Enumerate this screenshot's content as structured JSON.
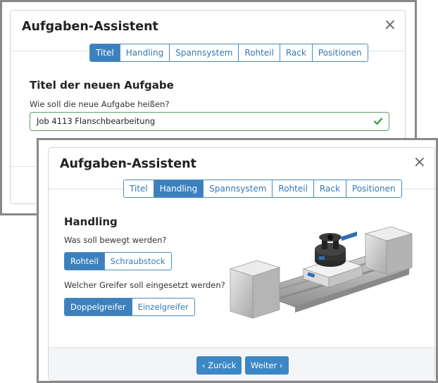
{
  "back_dialog": {
    "title": "Aufgaben-Assistent",
    "close_glyph": "×",
    "tabs": [
      "Titel",
      "Handling",
      "Spannsystem",
      "Rohteil",
      "Rack",
      "Positionen"
    ],
    "active_tab": "Titel",
    "section_title": "Titel der neuen Aufgabe",
    "question": "Wie soll die neue Aufgabe heißen?",
    "input_value": "Job 4113 Flanschbearbeitung",
    "input_valid": true
  },
  "front_dialog": {
    "title": "Aufgaben-Assistent",
    "close_glyph": "×",
    "tabs": [
      "Titel",
      "Handling",
      "Spannsystem",
      "Rohteil",
      "Rack",
      "Positionen"
    ],
    "active_tab": "Handling",
    "section_title": "Handling",
    "question_move": "Was soll bewegt werden?",
    "move_options": [
      "Rohteil",
      "Schraubstock"
    ],
    "move_selected": "Rohteil",
    "question_gripper": "Welcher Greifer soll eingesetzt werden?",
    "gripper_options": [
      "Doppelgreifer",
      "Einzelgreifer"
    ],
    "gripper_selected": "Doppelgreifer",
    "back_button": "‹ Zurück",
    "next_button": "Weiter ›",
    "image": "gripper-machine-illustration"
  },
  "colors": {
    "accent": "#3c81be",
    "valid": "#2e9a45",
    "border": "#cfd3d8"
  }
}
